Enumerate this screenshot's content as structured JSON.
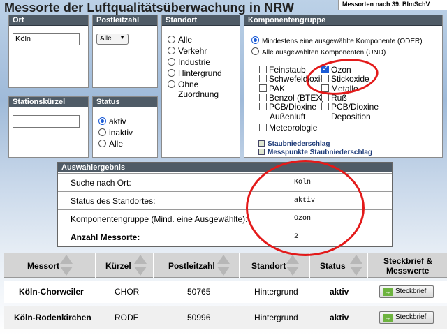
{
  "header": {
    "title": "Messorte der Luftqualitätsüberwachung in NRW",
    "regulation_tab": "Messorten nach 39. BImSchV"
  },
  "filters": {
    "ort": {
      "label": "Ort",
      "value": "Köln"
    },
    "plz": {
      "label": "Postleitzahl",
      "selected": "Alle"
    },
    "standort": {
      "label": "Standort",
      "options": [
        "Alle",
        "Verkehr",
        "Industrie",
        "Hintergrund",
        "Ohne",
        "Zuordnung"
      ]
    },
    "kuerzel": {
      "label": "Stationskürzel",
      "value": ""
    },
    "status": {
      "label": "Status",
      "options": [
        "aktiv",
        "inaktiv",
        "Alle"
      ],
      "selected": "aktiv"
    },
    "komponenten": {
      "label": "Komponentengruppe",
      "mode_any": "Mindestens eine ausgewählte Komponente (ODER)",
      "mode_all": "Alle ausgewählten Komponenten (UND)",
      "left": [
        "Feinstaub",
        "Schwefeldioxid",
        "PAK",
        "Benzol (BTEX)",
        "PCB/Dioxine",
        "Außenluft",
        "Meteorologie"
      ],
      "right": [
        "Ozon",
        "Stickoxide",
        "Metalle",
        "Ruß",
        "PCB/Dioxine",
        "Deposition"
      ],
      "checked": [
        "Ozon"
      ],
      "links": [
        "Staubniederschlag",
        "Messpunkte Staubniederschlag"
      ]
    }
  },
  "result": {
    "title": "Auswahlergebnis",
    "rows": [
      {
        "label": "Suche nach Ort:",
        "value": "Köln"
      },
      {
        "label": "Status des Standortes:",
        "value": "aktiv"
      },
      {
        "label": "Komponentengruppe (Mind. eine Ausgewählte):",
        "value": "Ozon"
      },
      {
        "label": "Anzahl Messorte:",
        "value": "2"
      }
    ]
  },
  "table": {
    "columns": [
      "Messort",
      "Kürzel",
      "Postleitzahl",
      "Standort",
      "Status",
      "Steckbrief &",
      "Messwerte"
    ],
    "rows": [
      {
        "messort": "Köln-Chorweiler",
        "kuerzel": "CHOR",
        "plz": "50765",
        "standort": "Hintergrund",
        "status": "aktiv",
        "button": "Steckbrief"
      },
      {
        "messort": "Köln-Rodenkirchen",
        "kuerzel": "RODE",
        "plz": "50996",
        "standort": "Hintergrund",
        "status": "aktiv",
        "button": "Steckbrief"
      }
    ]
  },
  "colors": {
    "annotation": "#e31a1a",
    "header_bg": "#4f5b66",
    "accent": "#1a5bd6"
  }
}
